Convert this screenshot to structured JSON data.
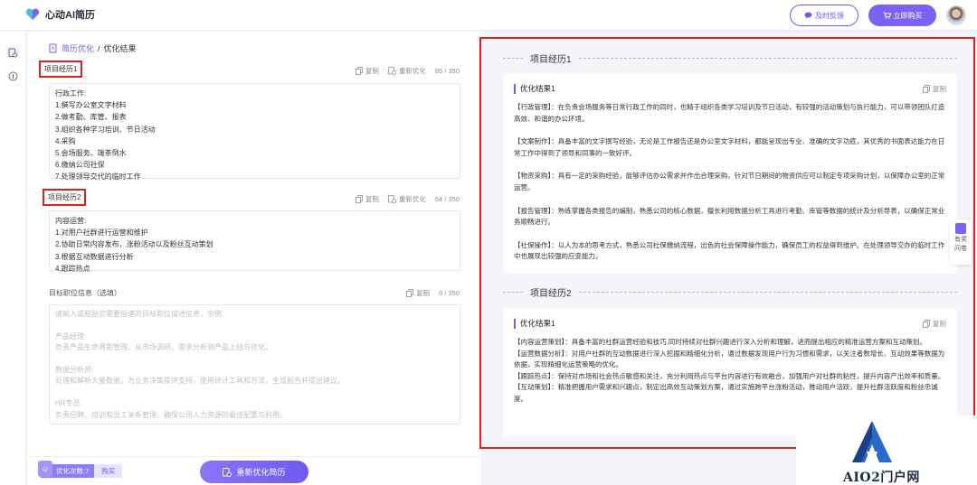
{
  "app": {
    "name": "心动AI简历",
    "feedback_label": "及时反馈",
    "buy_label": "立即购买",
    "brand_color": "#6e5bf0"
  },
  "breadcrumb": {
    "link": "简历优化",
    "separator": "/",
    "current": "优化结果"
  },
  "sections": [
    {
      "label": "项目经历1",
      "copy_label": "复制",
      "reoptimize_label": "重新优化",
      "count": "85 / 350",
      "lines": [
        "行政工作:",
        "1.撰写办公室文字材料",
        "2.做考勤、库管、报表",
        "3.组织各种学习培训、节日活动",
        "4.采购",
        "5.会场服务、端茶倒水",
        "6.缴纳公司社保",
        "7.处理领导交代的临时工作"
      ]
    },
    {
      "label": "项目经历2",
      "copy_label": "复制",
      "reoptimize_label": "重新优化",
      "count": "64 / 350",
      "lines": [
        "内容运营:",
        "1.对用户社群进行运营和维护",
        "2.协助日常内容发布，涨粉活动以及粉丝互动策划",
        "3.根据互动数据进行分析",
        "4.跟踪热点"
      ]
    }
  ],
  "target": {
    "label": "目标职位信息（选填）",
    "copy_label": "复制",
    "count": "0 / 350",
    "placeholder_lines": [
      "请输入或粘贴您需要投递的目标职位描述信息，示例:",
      "",
      "产品经理:",
      "负责产品生命周期管理、从市场调研、需求分析到产品上线与优化。",
      "",
      "数据分析师:",
      "处理和解析大量数据，为业务决策提供支持。使用统计工具和方法，生成报告并提出建议。",
      "",
      "HR专员:",
      "负责招聘、培训和员工关系管理，确保公司人力资源的最佳配置与利用。"
    ]
  },
  "bottom": {
    "quota_label": "优化次数:7",
    "buy_link": "购买",
    "reoptimize_button": "重新优化简历"
  },
  "results": [
    {
      "heading": "项目经历1",
      "card_title": "优化结果1",
      "copy_label": "复制",
      "paragraphs": [
        "【行政管理】：在负责会场服务等日常行政工作的同时，也精于组织各类学习培训及节日活动，有较强的活动策划与执行能力，可以带领团队打造高效、和谐的办公环境。",
        "【文案制作】：具备丰富的文字撰写经验，无论是工作报告还是办公室文字材料，都能呈现出专业、准确的文字功底，其优秀的书面表达能力在日常工作中得到了领导和同事的一致好评。",
        "【物资采购】：具有一定的采购经验，能够评估办公需求并作出合理采购，针对节日期间的物资供应可以制定专项采购计划，以保障办公室的正常运营。",
        "【报告管理】：熟练掌握各类报告的编制，熟悉公司的核心数据，擅长利用数据分析工具进行考勤、库管等数据的统计及分析导表，以确保正常业务顺畅进行。",
        "【社保操作】：以人为本的思考方式，熟悉公司社保缴纳流程，出色的社会保障操作能力，确保员工的权益得到维护。在处理领导交办的临时工作中也展现出较强的应变能力。"
      ]
    },
    {
      "heading": "项目经历2",
      "card_title": "优化结果1",
      "copy_label": "复制",
      "paragraphs": [
        "【内容运营策划】：具备丰富的社群运营经验和技巧,同时持续对社群兴趣进行深入分析和理解，进而提出相应的精准运营方案和互动策划。",
        "【运营数据分析】：对用户社群的互动数据进行深入挖掘和精细化分析，通过数据发现用户行为习惯和需求，以关注者数增长、互动效果等数据为依据，实现精细化运营策略的优化。",
        "【跟踪热点】：保持对市场和社会热点敏感和关注，充分利用热点与平台内容进行有效融合，加强用户对社群的粘性，提升内容产出效率和质量。",
        "【互动策划】：精准把握用户需求和兴趣点，制定出高效互动策划方案，通过实施跨平台涨粉活动，推动用户活跃，提升社群活跃度和粉丝忠诚度。"
      ]
    }
  ],
  "float_help": {
    "line1": "有奖",
    "line2": "问卷"
  },
  "watermark": {
    "text": "AIO2门户网"
  }
}
